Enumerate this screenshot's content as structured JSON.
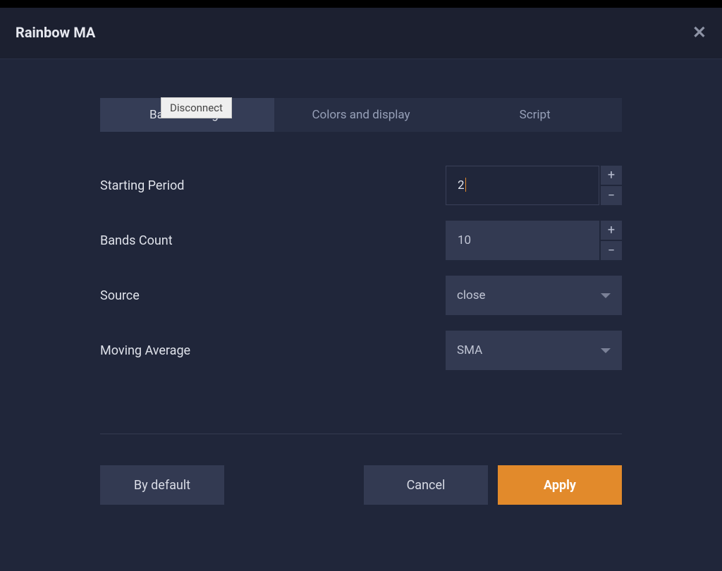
{
  "header": {
    "title": "Rainbow MA"
  },
  "tooltip": "Disconnect",
  "tabs": {
    "basic": "Basic settings",
    "colors": "Colors and display",
    "script": "Script"
  },
  "fields": {
    "starting_period": {
      "label": "Starting Period",
      "value": "2"
    },
    "bands_count": {
      "label": "Bands Count",
      "value": "10"
    },
    "source": {
      "label": "Source",
      "value": "close"
    },
    "moving_average": {
      "label": "Moving Average",
      "value": "SMA"
    }
  },
  "footer": {
    "default": "By default",
    "cancel": "Cancel",
    "apply": "Apply"
  }
}
